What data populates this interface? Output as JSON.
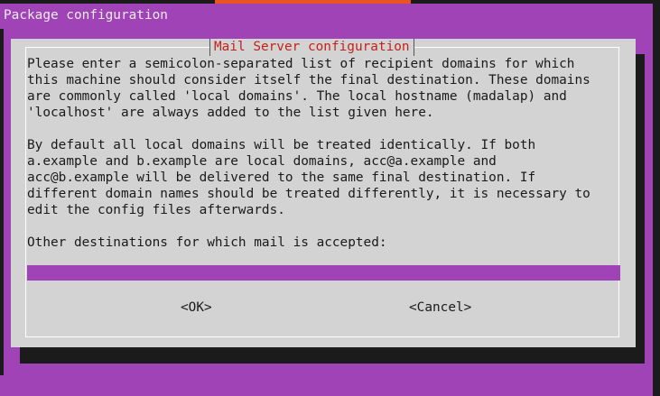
{
  "window": {
    "title": "Package configuration"
  },
  "dialog": {
    "title": "Mail Server configuration",
    "paragraph1": [
      "Please enter a semicolon-separated list of recipient domains for which",
      "this machine should consider itself the final destination. These domains",
      "are commonly called 'local domains'. The local hostname (madalap) and",
      "'localhost' are always added to the list given here."
    ],
    "paragraph2": [
      "By default all local domains will be treated identically. If both",
      "a.example and b.example are local domains, acc@a.example and",
      "acc@b.example will be delivered to the same final destination. If",
      "different domain names should be treated differently, it is necessary to",
      "edit the config files afterwards."
    ],
    "prompt": "Other destinations for which mail is accepted:",
    "input_value": "",
    "buttons": {
      "ok": "<OK>",
      "cancel": "<Cancel>"
    }
  },
  "colors": {
    "background": "#a043b6",
    "dialog": "#d3d3d3",
    "title_text": "#c0231a",
    "input_field": "#a043b6",
    "accent": "#e95420"
  }
}
